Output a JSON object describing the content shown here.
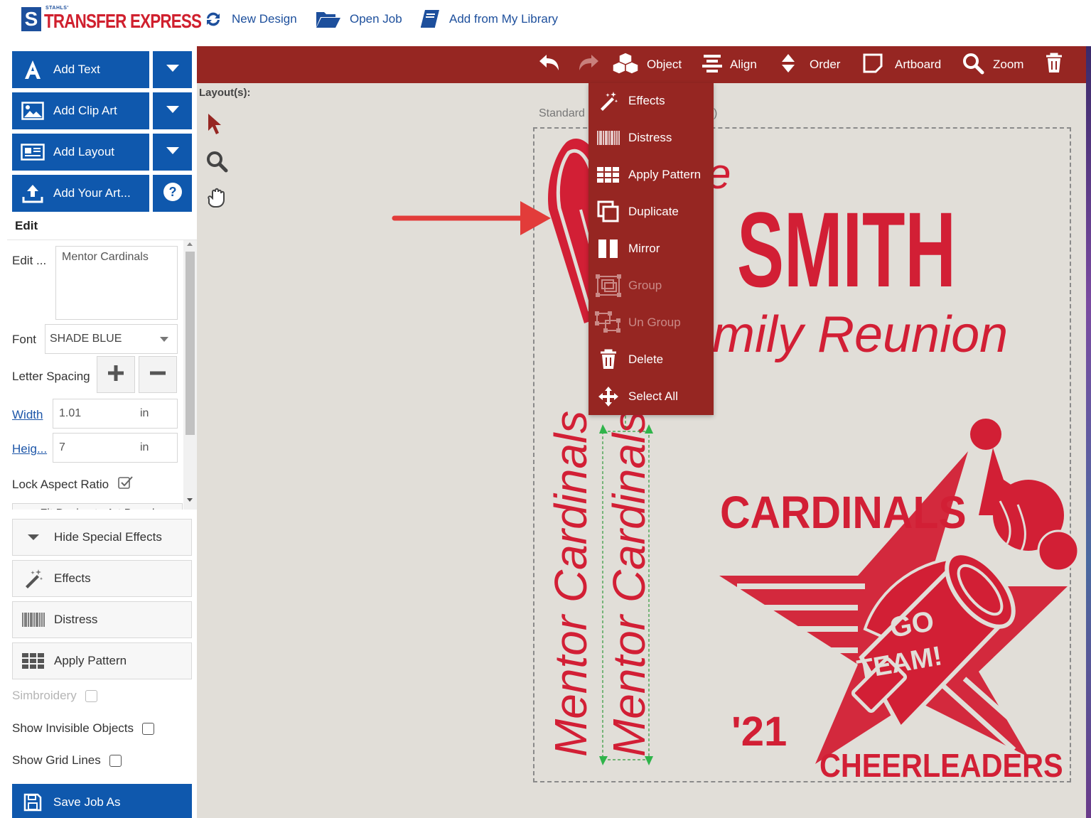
{
  "brand": {
    "small_text": "STAHLS'",
    "name": "TRANSFER EXPRESS",
    "letter": "S"
  },
  "top_nav": {
    "new_design": "New Design",
    "open_job": "Open Job",
    "add_from_library": "Add from My Library"
  },
  "left_panel": {
    "add_text": "Add Text",
    "add_clip_art": "Add Clip Art",
    "add_layout": "Add Layout",
    "add_your_art": "Add Your Art...",
    "edit_header": "Edit",
    "edit_label": "Edit ...",
    "edit_value": "Mentor Cardinals",
    "font_label": "Font",
    "font_value": "SHADE BLUE",
    "letter_spacing_label": "Letter Spacing",
    "width_label": "Width",
    "width_value": "1.01",
    "width_unit": "in",
    "height_label": "Heig...",
    "height_value": "7",
    "height_unit": "in",
    "lock_aspect_label": "Lock Aspect Ratio",
    "lock_aspect_checked": true,
    "fit_design_label": "Fit Design to Art Board",
    "hide_effects": "Hide Special Effects",
    "effects": "Effects",
    "distress": "Distress",
    "apply_pattern": "Apply Pattern",
    "simbroidery": "Simbroidery",
    "show_invisible": "Show Invisible Objects",
    "show_grid": "Show Grid Lines",
    "save_job_as": "Save Job As"
  },
  "toolbar": {
    "object": "Object",
    "align": "Align",
    "order": "Order",
    "artboard": "Artboard",
    "zoom": "Zoom"
  },
  "workspace": {
    "layouts_label": "Layout(s):",
    "standard_label": "Standard",
    "standard_suffix": ")"
  },
  "object_menu": {
    "items": [
      {
        "label": "Effects",
        "enabled": true,
        "icon": "magic-wand-icon"
      },
      {
        "label": "Distress",
        "enabled": true,
        "icon": "barcode-icon"
      },
      {
        "label": "Apply Pattern",
        "enabled": true,
        "icon": "grid-icon"
      },
      {
        "label": "Duplicate",
        "enabled": true,
        "icon": "duplicate-icon"
      },
      {
        "label": "Mirror",
        "enabled": true,
        "icon": "mirror-icon"
      },
      {
        "label": "Group",
        "enabled": false,
        "icon": "group-icon"
      },
      {
        "label": "Un Group",
        "enabled": false,
        "icon": "ungroup-icon"
      },
      {
        "label": "Delete",
        "enabled": true,
        "icon": "trash-icon"
      },
      {
        "label": "Select All",
        "enabled": true,
        "icon": "select-all-icon"
      }
    ]
  },
  "design": {
    "smith": "SMITH",
    "reunion": "mily Reunion",
    "script_partial": "e",
    "mentor_1": "Mentor Cardinals",
    "mentor_2": "Mentor Cardinals",
    "cardinals": "CARDINALS",
    "go": "GO",
    "team": "TEAM!",
    "year": "'21",
    "cheerleaders": "CHEERLEADERS"
  },
  "colors": {
    "brand_blue": "#0f58ad",
    "toolbar_red": "#962622",
    "design_red": "#d21f35",
    "canvas_bg": "#e1ded8"
  }
}
